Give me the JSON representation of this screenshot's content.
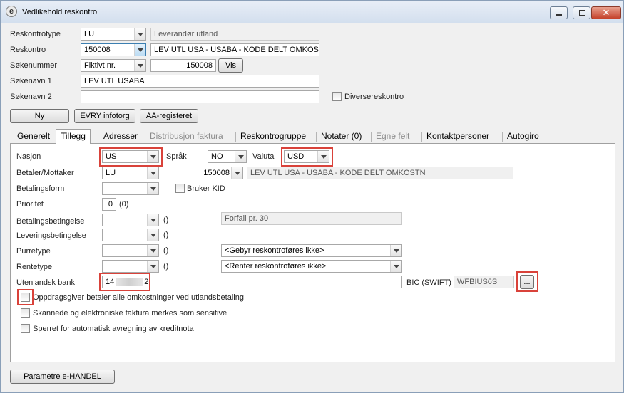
{
  "window": {
    "title": "Vedlikehold reskontro",
    "app_icon": "e",
    "icons": {
      "app": "app-logo-icon",
      "min": "minimize-icon",
      "max": "maximize-icon",
      "close": "close-icon"
    },
    "close_glyph": "✕"
  },
  "header": {
    "reskontrotype": {
      "label": "Reskontrotype",
      "value": "LU",
      "desc": "Leverandør utland"
    },
    "reskontro": {
      "label": "Reskontro",
      "value": "150008",
      "desc": "LEV UTL USA - USABA - KODE DELT OMKOSTN"
    },
    "sokenummer": {
      "label": "Søkenummer",
      "type": "Fiktivt nr.",
      "value": "150008",
      "button": "Vis"
    },
    "sokenavn1": {
      "label": "Søkenavn 1",
      "value": "LEV UTL USABA"
    },
    "sokenavn2": {
      "label": "Søkenavn 2",
      "value": ""
    },
    "diverse": {
      "label": "Diversereskontro",
      "checked": false
    }
  },
  "buttons": {
    "ny": "Ny",
    "evry": "EVRY infotorg",
    "aa": "AA-registeret",
    "parametre": "Parametre e-HANDEL"
  },
  "tabs": [
    "Generelt",
    "Tillegg",
    "Adresser",
    "Distribusjon faktura",
    "Reskontrogruppe",
    "Notater (0)",
    "Egne felt",
    "Kontaktpersoner",
    "Autogiro"
  ],
  "active_tab": "Tillegg",
  "tillegg": {
    "nasjon": {
      "label": "Nasjon",
      "value": "US"
    },
    "sprak": {
      "label": "Språk",
      "value": "NO"
    },
    "valuta": {
      "label": "Valuta",
      "value": "USD"
    },
    "betaler": {
      "label": "Betaler/Mottaker",
      "type": "LU",
      "value": "150008",
      "desc": "LEV UTL USA - USABA - KODE DELT OMKOSTN"
    },
    "betalingsform": {
      "label": "Betalingsform",
      "value": ""
    },
    "bruker_kid": {
      "label": "Bruker KID",
      "checked": false
    },
    "prioritet": {
      "label": "Prioritet",
      "value": "0",
      "paren": "(0)"
    },
    "betalingsbetingelse": {
      "label": "Betalingsbetingelse",
      "value": "",
      "paren": "()",
      "desc": "Forfall pr. 30"
    },
    "leveringsbetingelse": {
      "label": "Leveringsbetingelse",
      "value": "",
      "paren": "()"
    },
    "purretype": {
      "label": "Purretype",
      "value": "",
      "paren": "()",
      "option": "<Gebyr reskontroføres ikke>"
    },
    "rentetype": {
      "label": "Rentetype",
      "value": "",
      "paren": "()",
      "option": "<Renter reskontroføres ikke>"
    },
    "utenlandsk_bank": {
      "label": "Utenlandsk bank",
      "value_start": "14",
      "value_end": "2"
    },
    "bic": {
      "label": "BIC (SWIFT)",
      "value": "WFBIUS6S",
      "button": "..."
    },
    "checks": [
      {
        "label": "Oppdragsgiver betaler alle omkostninger ved utlandsbetaling",
        "checked": false
      },
      {
        "label": "Skannede og elektroniske faktura merkes som sensitive",
        "checked": false
      },
      {
        "label": "Sperret for automatisk avregning av kreditnota",
        "checked": false
      }
    ]
  },
  "colors": {
    "highlight": "#d9423a",
    "titlebar": "#d3dfee",
    "focus": "#3c7fb1"
  }
}
